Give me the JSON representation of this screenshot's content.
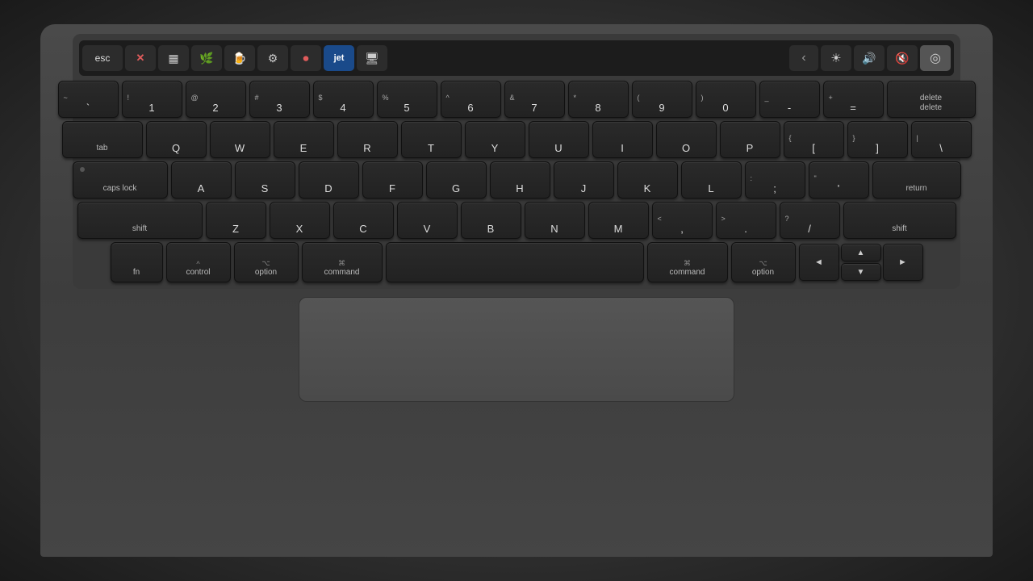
{
  "touchbar": {
    "esc": "esc",
    "apps": [
      {
        "id": "close",
        "icon": "✕",
        "active": false,
        "color": "#e05c5c"
      },
      {
        "id": "tabletool",
        "icon": "⣿",
        "active": false
      },
      {
        "id": "leaf",
        "icon": "🌿",
        "active": false
      },
      {
        "id": "beer",
        "icon": "🍺",
        "active": false
      },
      {
        "id": "gear",
        "icon": "⚙",
        "active": false
      },
      {
        "id": "circle-rec",
        "icon": "⏺",
        "active": false
      },
      {
        "id": "jet",
        "icon": "jet",
        "active": true
      },
      {
        "id": "screen",
        "icon": "🖥",
        "active": false
      }
    ],
    "controls": [
      {
        "id": "angle",
        "icon": "‹"
      },
      {
        "id": "brightness",
        "icon": "☀"
      },
      {
        "id": "volume",
        "icon": "🔊"
      },
      {
        "id": "mute",
        "icon": "🔇"
      },
      {
        "id": "siri",
        "icon": "◉"
      }
    ]
  },
  "keyboard": {
    "row1": [
      {
        "top": "~",
        "main": "`"
      },
      {
        "top": "!",
        "main": "1"
      },
      {
        "top": "@",
        "main": "2"
      },
      {
        "top": "#",
        "main": "3"
      },
      {
        "top": "$",
        "main": "4"
      },
      {
        "top": "%",
        "main": "5"
      },
      {
        "top": "^",
        "main": "6"
      },
      {
        "top": "&",
        "main": "7"
      },
      {
        "top": "*",
        "main": "8"
      },
      {
        "top": "(",
        "main": "9"
      },
      {
        "top": ")",
        "main": "0"
      },
      {
        "top": "_",
        "main": "-"
      },
      {
        "top": "+",
        "main": "="
      },
      {
        "main": "delete"
      }
    ],
    "row2": [
      "tab",
      "Q",
      "W",
      "E",
      "R",
      "T",
      "Y",
      "U",
      "I",
      "O",
      "P",
      "{[",
      "]}",
      "|\\"
    ],
    "row3": [
      "caps lock",
      "A",
      "S",
      "D",
      "F",
      "G",
      "H",
      "J",
      "K",
      "L",
      ":;",
      "\"'",
      "return"
    ],
    "row4": [
      "shift",
      "Z",
      "X",
      "C",
      "V",
      "B",
      "N",
      "M",
      "<,",
      ">.",
      "?/",
      "shift"
    ],
    "row5": [
      "fn",
      "control",
      "option",
      "command",
      "",
      "command",
      "option",
      "◄",
      "▲▼",
      "►"
    ]
  },
  "modifiers": {
    "fn": "fn",
    "control_sym": "^",
    "control": "control",
    "option_sym": "⌥",
    "option": "option",
    "command_sym": "⌘",
    "command": "command",
    "shift": "shift",
    "tab": "tab",
    "caps_lock": "caps lock",
    "esc": "esc",
    "delete": "delete",
    "return": "return"
  },
  "arrows": {
    "up": "▲",
    "down": "▼",
    "left": "◄",
    "right": "►"
  }
}
